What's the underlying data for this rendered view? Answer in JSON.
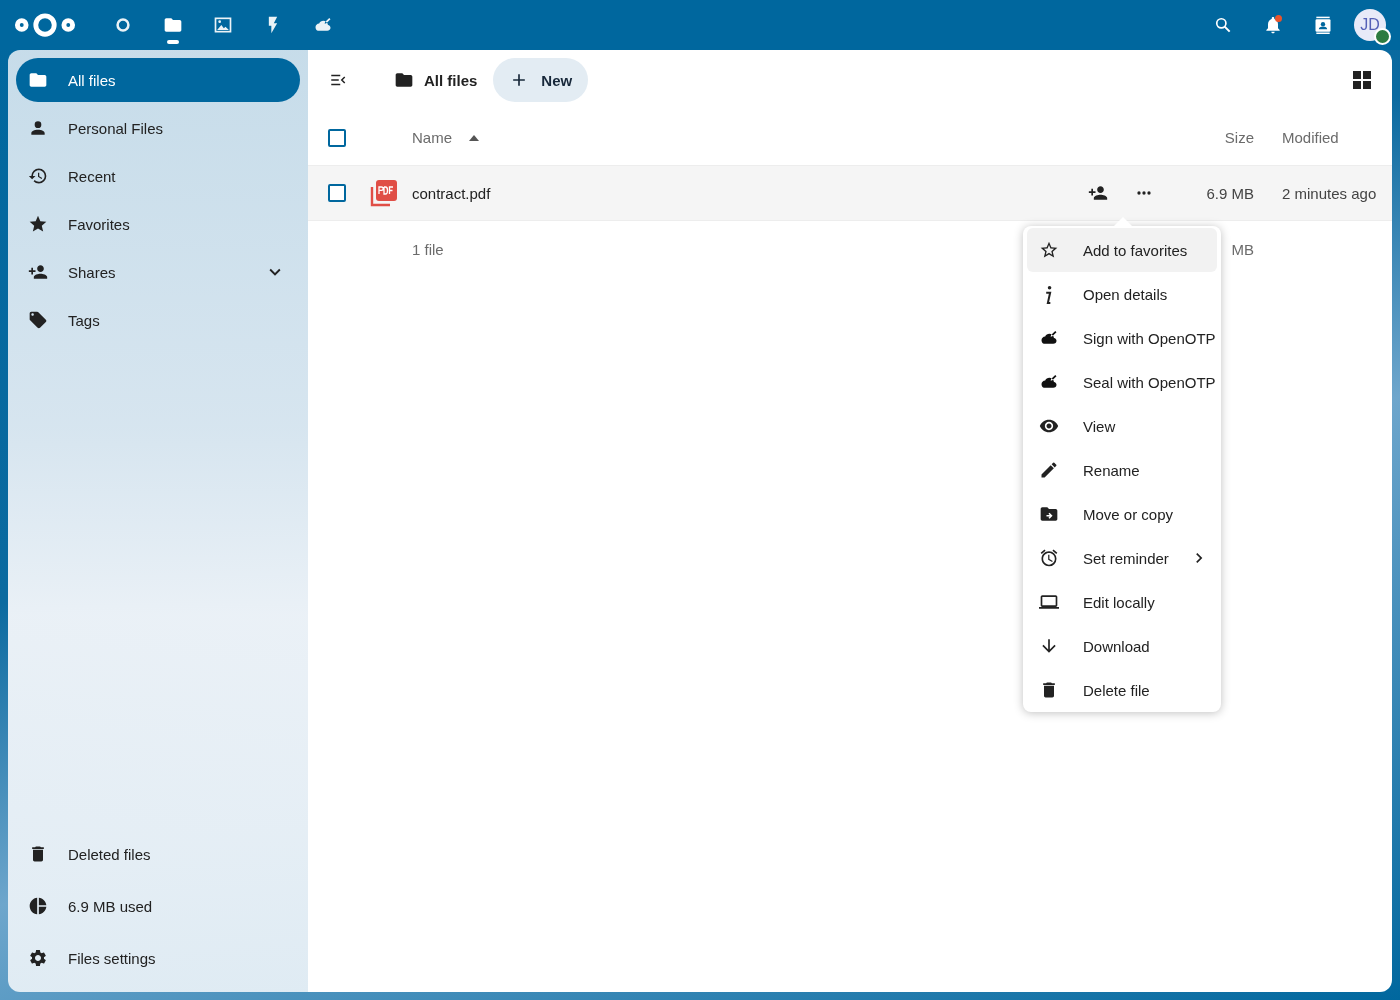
{
  "top_bar": {
    "apps": [
      {
        "selected": false
      },
      {
        "selected": true
      },
      {
        "selected": false
      },
      {
        "selected": false
      },
      {
        "selected": false
      }
    ],
    "notifications": {
      "unread": true
    },
    "avatar": {
      "initials": "JD",
      "online": true
    }
  },
  "sidebar": {
    "items": [
      {
        "label": "All files",
        "selected": true,
        "kind": "link"
      },
      {
        "label": "Personal Files",
        "selected": false,
        "kind": "link"
      },
      {
        "label": "Recent",
        "selected": false,
        "kind": "link"
      },
      {
        "label": "Favorites",
        "selected": false,
        "kind": "link"
      },
      {
        "label": "Shares",
        "selected": false,
        "kind": "group",
        "expanded": false
      },
      {
        "label": "Tags",
        "selected": false,
        "kind": "link"
      }
    ],
    "footer_items": [
      {
        "label": "Deleted files"
      },
      {
        "label": "6.9 MB used"
      },
      {
        "label": "Files settings"
      }
    ]
  },
  "toolbar": {
    "breadcrumb": "All files",
    "new_button": "New"
  },
  "table": {
    "select_all": {
      "checked": false
    },
    "columns": [
      {
        "label": "Name",
        "sorted": true
      },
      {
        "label": "Size",
        "sorted": false
      },
      {
        "label": "Modified",
        "sorted": false
      }
    ],
    "rows": [
      {
        "name": "contract.pdf",
        "checked": false,
        "size": "6.9 MB",
        "modified": "2 minutes ago"
      }
    ],
    "footer": {
      "count": "1 file",
      "size": "MB"
    }
  },
  "context_menu": {
    "items": [
      {
        "label": "Add to favorites",
        "selected": true,
        "submenu": false
      },
      {
        "label": "Open details",
        "selected": false,
        "submenu": false
      },
      {
        "label": "Sign with OpenOTP",
        "selected": false,
        "submenu": false
      },
      {
        "label": "Seal with OpenOTP",
        "selected": false,
        "submenu": false
      },
      {
        "label": "View",
        "selected": false,
        "submenu": false
      },
      {
        "label": "Rename",
        "selected": false,
        "submenu": false
      },
      {
        "label": "Move or copy",
        "selected": false,
        "submenu": false
      },
      {
        "label": "Set reminder",
        "selected": false,
        "submenu": true
      },
      {
        "label": "Edit locally",
        "selected": false,
        "submenu": false
      },
      {
        "label": "Download",
        "selected": false,
        "submenu": false
      },
      {
        "label": "Delete file",
        "selected": false,
        "submenu": false
      }
    ]
  }
}
